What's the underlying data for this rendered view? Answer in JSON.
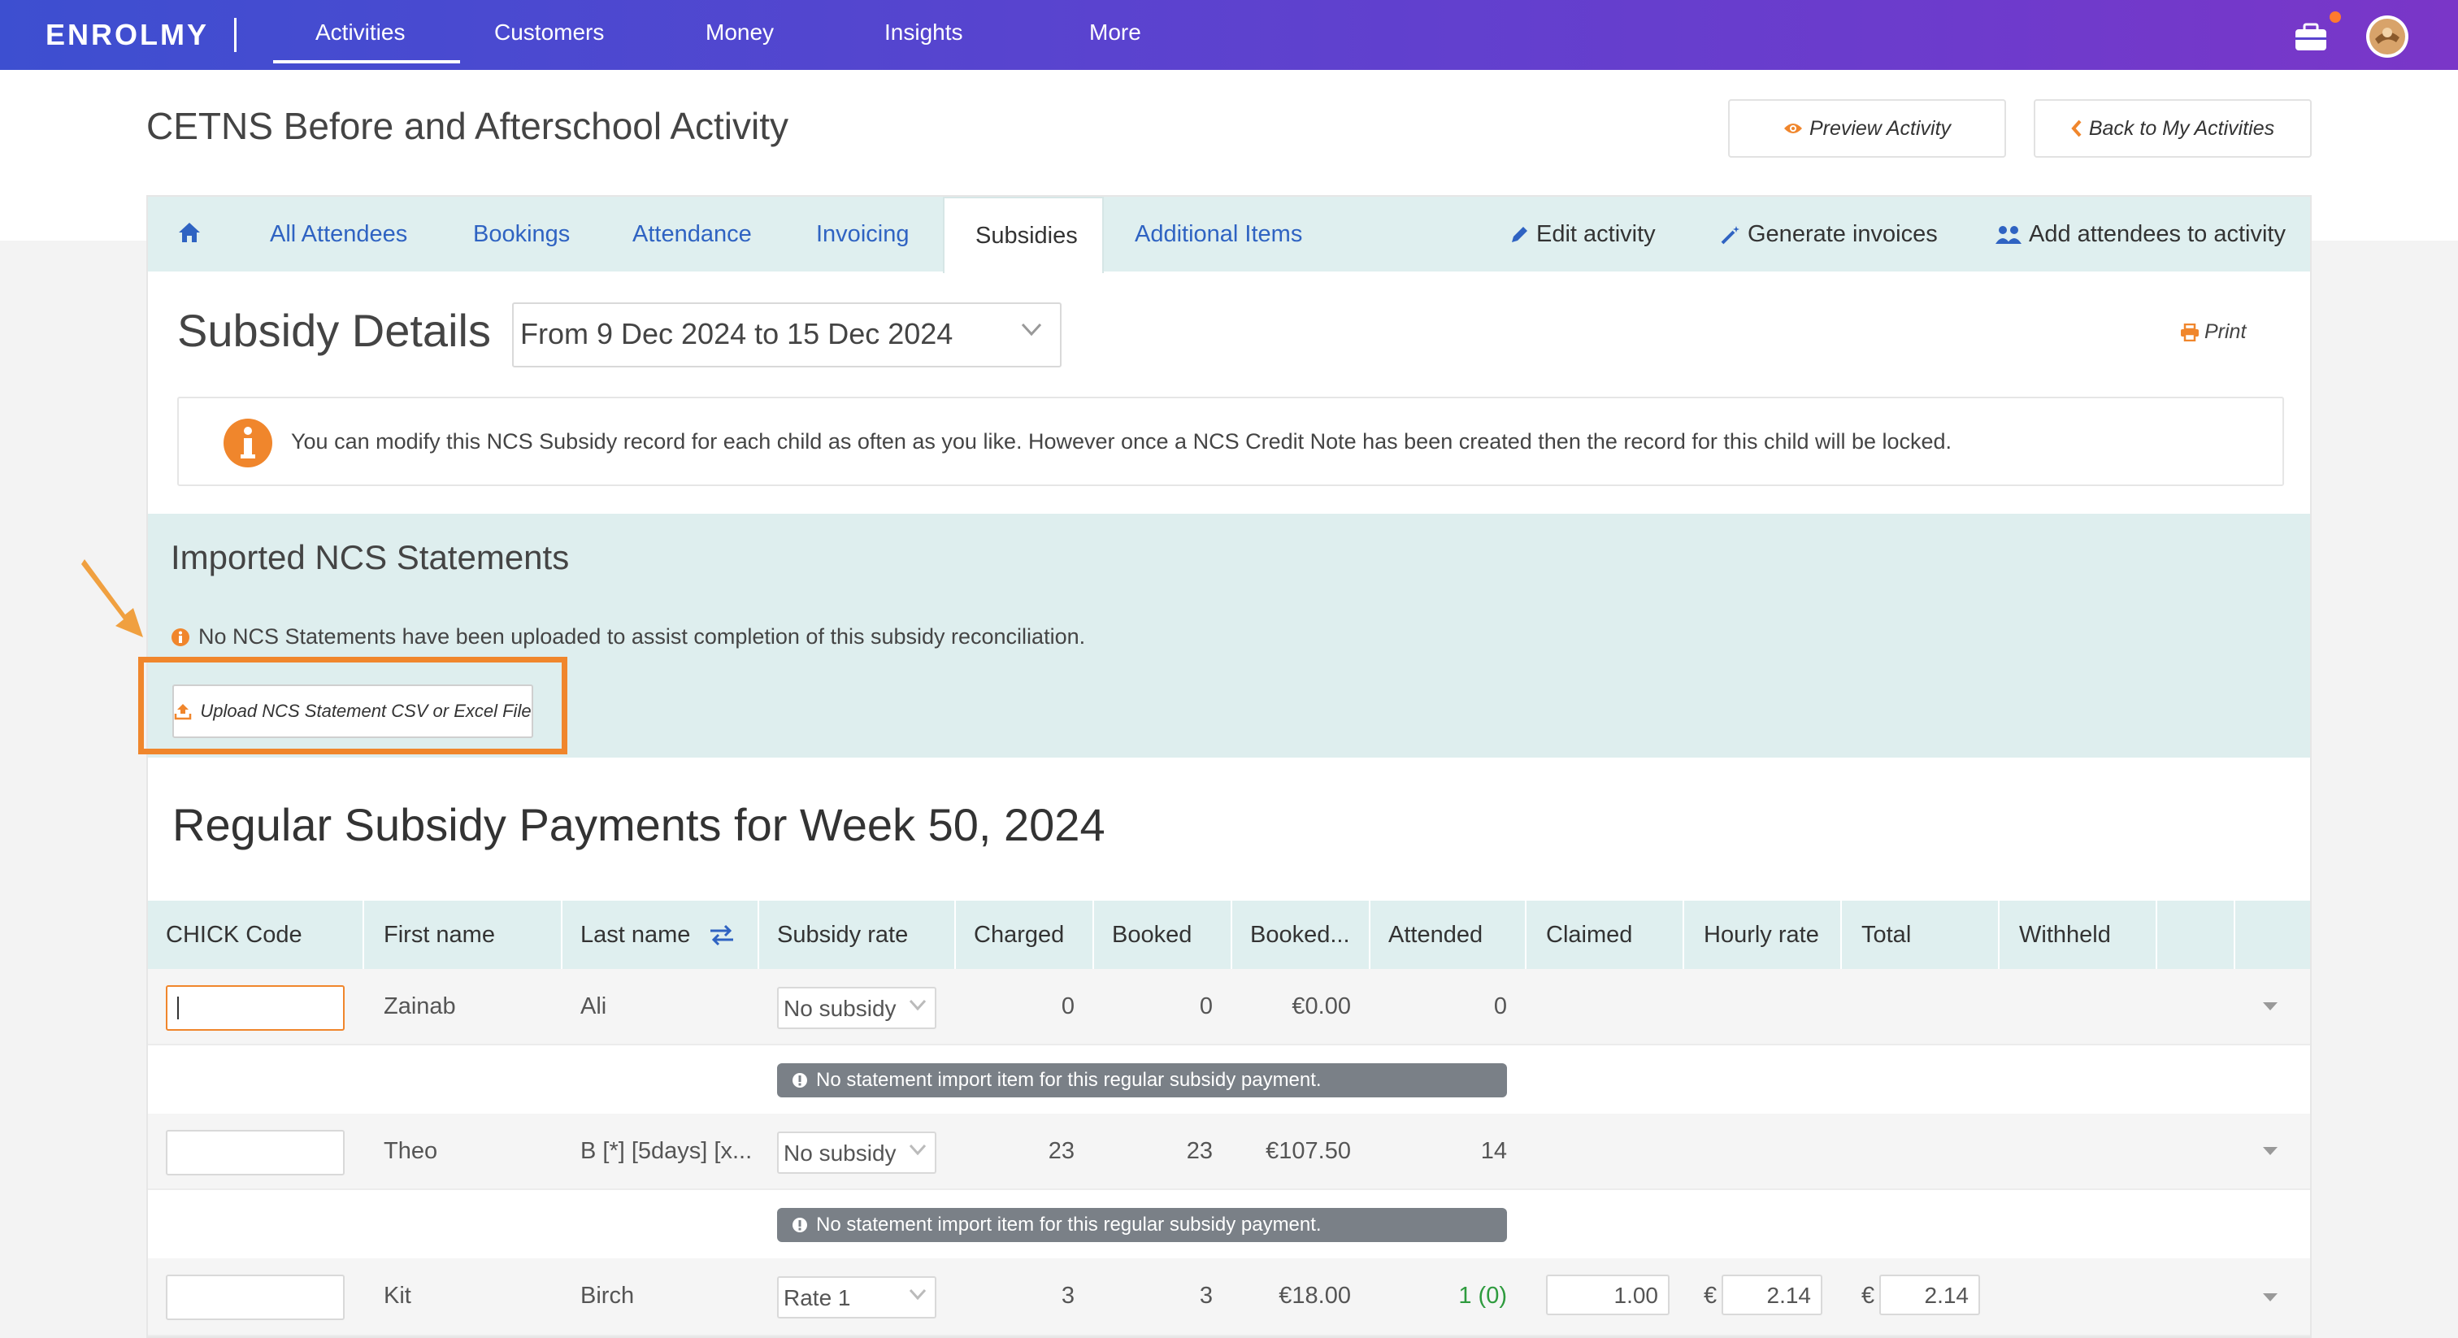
{
  "nav": {
    "logo": "ENROLMY",
    "items": [
      "Activities",
      "Customers",
      "Money",
      "Insights",
      "More"
    ]
  },
  "header": {
    "title": "CETNS Before and Afterschool Activity",
    "preview_label": "Preview Activity",
    "back_label": "Back to My Activities"
  },
  "tabs": {
    "items": [
      "All Attendees",
      "Bookings",
      "Attendance",
      "Invoicing",
      "Subsidies",
      "Additional Items"
    ],
    "actions": [
      "Edit activity",
      "Generate invoices",
      "Add attendees to activity"
    ]
  },
  "subsidy": {
    "title": "Subsidy Details",
    "week_range": "From 9 Dec 2024 to 15 Dec 2024",
    "print_label": "Print",
    "info_text": "You can modify this NCS Subsidy record for each child as often as you like. However once a NCS Credit Note has been created then the record for this child will be locked."
  },
  "ncs": {
    "title": "Imported NCS Statements",
    "note": "No NCS Statements have been uploaded to assist completion of this subsidy reconciliation.",
    "upload_label": "Upload NCS Statement CSV or Excel File"
  },
  "regular": {
    "title": "Regular Subsidy Payments for Week 50, 2024"
  },
  "table": {
    "headers": [
      "CHICK Code",
      "First name",
      "Last name",
      "Subsidy rate",
      "Charged",
      "Booked",
      "Booked...",
      "Attended",
      "Claimed",
      "Hourly rate",
      "Total",
      "Withheld"
    ],
    "no_import_message": "No statement import item for this regular subsidy payment.",
    "currency": "€",
    "rows": [
      {
        "chick": "",
        "first": "Zainab",
        "last": "Ali",
        "rate": "No subsidy",
        "charged": "0",
        "booked": "0",
        "booked_amount": "€0.00",
        "attended": "0"
      },
      {
        "chick": "",
        "first": "Theo",
        "last": "B [*] [5days] [x...",
        "rate": "No subsidy",
        "charged": "23",
        "booked": "23",
        "booked_amount": "€107.50",
        "attended": "14"
      },
      {
        "chick": "",
        "first": "Kit",
        "last": "Birch",
        "rate": "Rate 1",
        "charged": "3",
        "booked": "3",
        "booked_amount": "€18.00",
        "attended": "1",
        "attended_extra": "(0)",
        "claimed": "1.00",
        "hourly": "2.14",
        "total": "2.14"
      }
    ]
  },
  "colors": {
    "nav_gradient_start": "#3d4fd0",
    "nav_gradient_end": "#7a36c8",
    "link_blue": "#2f63c2",
    "accent_orange": "#f0862c",
    "panel_teal": "#deeeee",
    "green": "#2e9b3e"
  }
}
